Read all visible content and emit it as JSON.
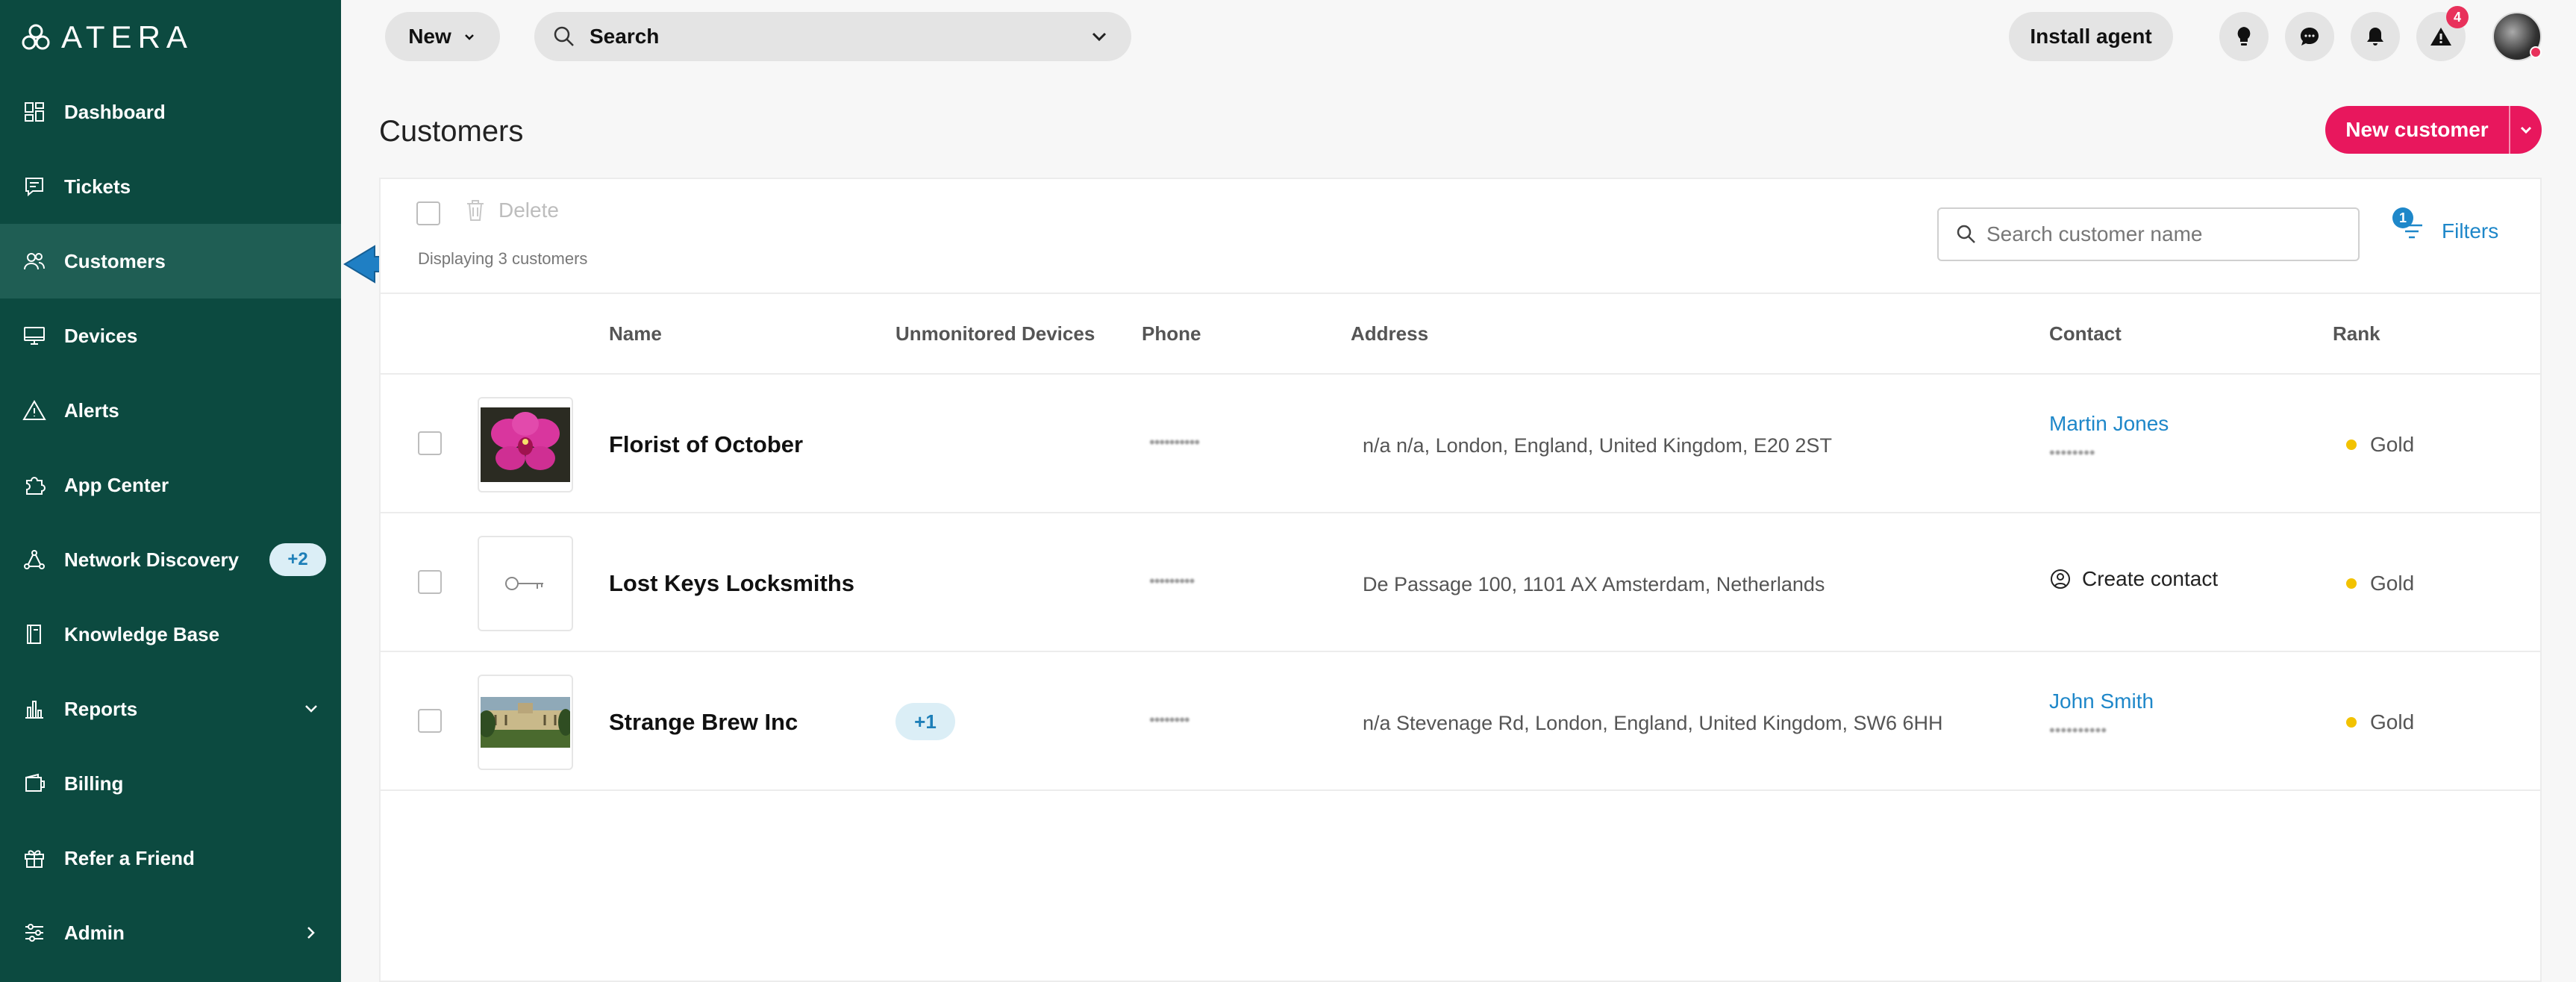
{
  "app": {
    "logo_text": "ATERA"
  },
  "sidebar": {
    "items": [
      {
        "label": "Dashboard",
        "icon": "dashboard-icon"
      },
      {
        "label": "Tickets",
        "icon": "tickets-icon"
      },
      {
        "label": "Customers",
        "icon": "customers-icon",
        "active": true
      },
      {
        "label": "Devices",
        "icon": "devices-icon"
      },
      {
        "label": "Alerts",
        "icon": "alerts-icon"
      },
      {
        "label": "App Center",
        "icon": "app-center-icon"
      },
      {
        "label": "Network Discovery",
        "icon": "network-discovery-icon",
        "badge": "+2"
      },
      {
        "label": "Knowledge Base",
        "icon": "knowledge-base-icon"
      },
      {
        "label": "Reports",
        "icon": "reports-icon",
        "expand": "chevron-down-icon"
      },
      {
        "label": "Billing",
        "icon": "billing-icon"
      },
      {
        "label": "Refer a Friend",
        "icon": "gift-icon"
      },
      {
        "label": "Admin",
        "icon": "admin-icon",
        "expand": "chevron-right-icon"
      }
    ]
  },
  "topbar": {
    "new_label": "New",
    "search_label": "Search",
    "install_label": "Install agent",
    "alert_count": "4"
  },
  "page": {
    "title": "Customers",
    "new_customer_label": "New customer"
  },
  "toolbar": {
    "delete_label": "Delete",
    "displaying": "Displaying 3 customers",
    "search_placeholder": "Search customer name",
    "filters_label": "Filters",
    "filters_count": "1"
  },
  "table": {
    "headers": {
      "name": "Name",
      "unmonitored": "Unmonitored Devices",
      "phone": "Phone",
      "address": "Address",
      "contact": "Contact",
      "rank": "Rank"
    },
    "rows": [
      {
        "name": "Florist of October",
        "thumbnail": "orchid-photo",
        "unmonitored": "",
        "phone": "••••••••••",
        "address": "n/a n/a, London, England, United Kingdom, E20 2ST",
        "contact_name": "Martin Jones",
        "contact_phone": "••••••••",
        "rank": "Gold"
      },
      {
        "name": "Lost Keys Locksmiths",
        "thumbnail": "key-icon",
        "unmonitored": "",
        "phone": "•••••••••",
        "address": "De Passage 100, 1101 AX Amsterdam, Netherlands",
        "contact_action": "Create contact",
        "rank": "Gold"
      },
      {
        "name": "Strange Brew Inc",
        "thumbnail": "building-photo",
        "unmonitored": "+1",
        "phone": "••••••••",
        "address": "n/a Stevenage Rd, London, England, United Kingdom, SW6 6HH",
        "contact_name": "John Smith",
        "contact_phone": "••••••••••",
        "rank": "Gold"
      }
    ]
  },
  "colors": {
    "sidebar_bg": "#0c4a40",
    "sidebar_active": "#1f5e54",
    "accent_pink": "#e8175d",
    "link_blue": "#1e87c9",
    "rank_gold": "#f2c200"
  }
}
